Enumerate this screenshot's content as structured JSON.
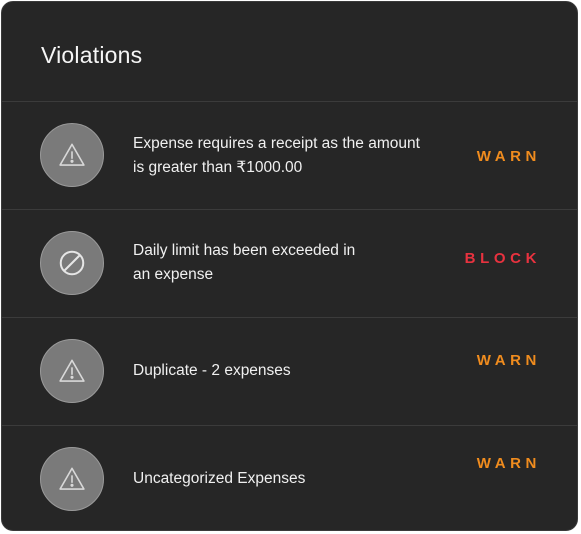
{
  "panel": {
    "title": "Violations"
  },
  "colors": {
    "warn": "#f08c1e",
    "block": "#e8323f"
  },
  "violations": [
    {
      "icon": "warning-triangle-icon",
      "message": "Expense requires a receipt as the amount is greater than ₹1000.00",
      "level": "WARN"
    },
    {
      "icon": "blocked-circle-icon",
      "message": "Daily limit has been exceeded in an expense",
      "level": "BLOCK"
    },
    {
      "icon": "warning-triangle-icon",
      "message": "Duplicate - 2 expenses",
      "level": "WARN"
    },
    {
      "icon": "warning-triangle-icon",
      "message": "Uncategorized Expenses",
      "level": "WARN"
    }
  ]
}
